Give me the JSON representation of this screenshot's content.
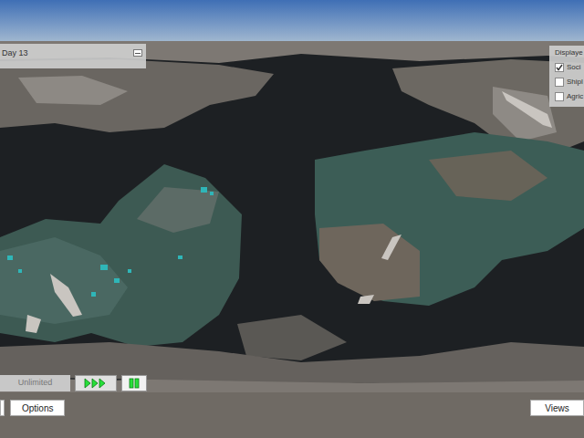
{
  "day_panel": {
    "title": "Day 13"
  },
  "display_panel": {
    "title": "Displaye",
    "options": [
      {
        "label": "Soci",
        "checked": true
      },
      {
        "label": "Shipl",
        "checked": false
      },
      {
        "label": "Agric",
        "checked": false
      }
    ]
  },
  "speed": {
    "label": "Unlimited"
  },
  "bottom_bar": {
    "left_buttons": [
      "Options"
    ],
    "right_buttons": [
      "Views"
    ]
  }
}
